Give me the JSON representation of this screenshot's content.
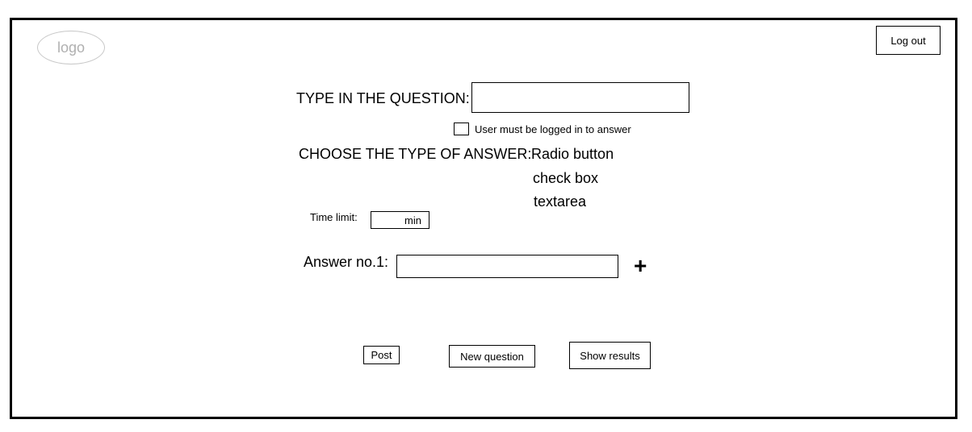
{
  "header": {
    "logo_text": "logo",
    "logout_label": "Log out"
  },
  "form": {
    "question_label": "TYPE IN THE QUESTION:",
    "question_value": "",
    "login_required_label": "User must be logged in to answer",
    "login_required_checked": false,
    "answer_type_label": "CHOOSE THE TYPE OF ANSWER:",
    "answer_types": [
      "Radio button",
      "check box",
      "textarea"
    ],
    "time_limit_label": "Time limit:",
    "time_limit_unit": "min",
    "answer_label": "Answer no.1:",
    "answer_value": "",
    "add_answer_symbol": "+"
  },
  "actions": {
    "post_label": "Post",
    "new_question_label": "New question",
    "show_results_label": "Show results"
  }
}
